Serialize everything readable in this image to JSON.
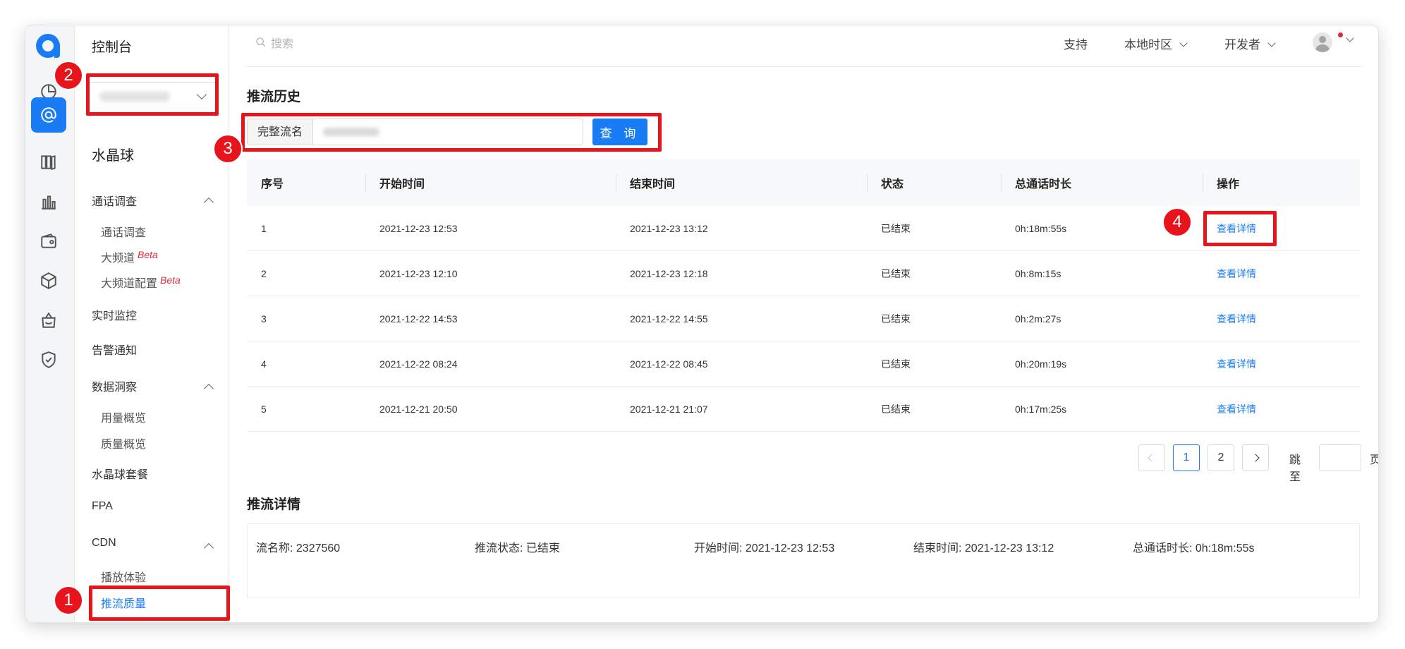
{
  "sidebar": {
    "title": "控制台",
    "product": "水晶球",
    "groups": [
      {
        "label": "通话调查",
        "children": [
          {
            "label": "通话调查",
            "beta": ""
          },
          {
            "label": "大频道",
            "beta": "Beta"
          },
          {
            "label": "大频道配置",
            "beta": "Beta"
          }
        ]
      },
      {
        "label": "实时监控"
      },
      {
        "label": "告警通知"
      },
      {
        "label": "数据洞察",
        "children": [
          {
            "label": "用量概览"
          },
          {
            "label": "质量概览"
          }
        ]
      },
      {
        "label": "水晶球套餐"
      },
      {
        "label": "FPA"
      },
      {
        "label": "CDN",
        "children": [
          {
            "label": "播放体验"
          },
          {
            "label": "推流质量"
          }
        ]
      }
    ],
    "active_item": "推流质量"
  },
  "rail_icons": [
    "logo-icon",
    "chart-pie-icon",
    "at-sign-icon",
    "book-icon",
    "bar-chart-icon",
    "wallet-icon",
    "cube-icon",
    "bag-icon",
    "shield-check-icon"
  ],
  "header": {
    "search_placeholder": "搜索",
    "links": [
      "支持",
      "本地时区",
      "开发者"
    ]
  },
  "history": {
    "title": "推流历史",
    "query_label": "完整流名",
    "query_button": "查 询",
    "columns": [
      "序号",
      "开始时间",
      "结束时间",
      "状态",
      "总通话时长",
      "操作"
    ],
    "rows": [
      {
        "no": "1",
        "start": "2021-12-23 12:53",
        "end": "2021-12-23 13:12",
        "status": "已结束",
        "duration": "0h:18m:55s",
        "action": "查看详情"
      },
      {
        "no": "2",
        "start": "2021-12-23 12:10",
        "end": "2021-12-23 12:18",
        "status": "已结束",
        "duration": "0h:8m:15s",
        "action": "查看详情"
      },
      {
        "no": "3",
        "start": "2021-12-22 14:53",
        "end": "2021-12-22 14:55",
        "status": "已结束",
        "duration": "0h:2m:27s",
        "action": "查看详情"
      },
      {
        "no": "4",
        "start": "2021-12-22 08:24",
        "end": "2021-12-22 08:45",
        "status": "已结束",
        "duration": "0h:20m:19s",
        "action": "查看详情"
      },
      {
        "no": "5",
        "start": "2021-12-21 20:50",
        "end": "2021-12-21 21:07",
        "status": "已结束",
        "duration": "0h:17m:25s",
        "action": "查看详情"
      }
    ],
    "pagination": {
      "pages": [
        "1",
        "2"
      ],
      "current": "1",
      "jump_label": "跳至",
      "page_suffix": "页"
    }
  },
  "detail": {
    "title": "推流详情",
    "items": [
      "流名称: 2327560",
      "推流状态: 已结束",
      "开始时间: 2021-12-23 12:53",
      "结束时间: 2021-12-23 13:12",
      "总通话时长: 0h:18m:55s"
    ]
  },
  "annotations": [
    "1",
    "2",
    "3",
    "4"
  ],
  "colors": {
    "accent": "#1a7cf5",
    "annotation": "#e8141c",
    "beta": "#e0283a"
  }
}
